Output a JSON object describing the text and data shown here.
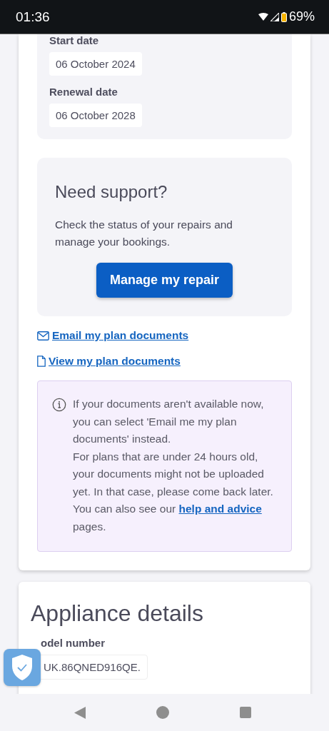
{
  "status_bar": {
    "time": "01:36",
    "battery": "69%"
  },
  "plan_dates": [
    {
      "label": "Start date",
      "value": "06 October 2024"
    },
    {
      "label": "Renewal date",
      "value": "06 October 2028"
    }
  ],
  "support": {
    "title": "Need support?",
    "text": "Check the status of your repairs and manage your bookings.",
    "button": "Manage my repair"
  },
  "links": [
    {
      "kind": "email",
      "label": "Email my plan documents"
    },
    {
      "kind": "document",
      "label": "View my plan documents"
    }
  ],
  "info": {
    "lines": [
      "If your documents aren't available now, you can select 'Email me my plan documents' instead.",
      "For plans that are under 24 hours old, your documents might not be uploaded yet. In that case, please come back later."
    ],
    "last_line_before": "You can also see our",
    "last_line_link": "help and advice",
    "last_line_after": "pages."
  },
  "appliance": {
    "title": "Appliance details",
    "field_label": "odel number",
    "field_value": "UK.86QNED916QE."
  }
}
